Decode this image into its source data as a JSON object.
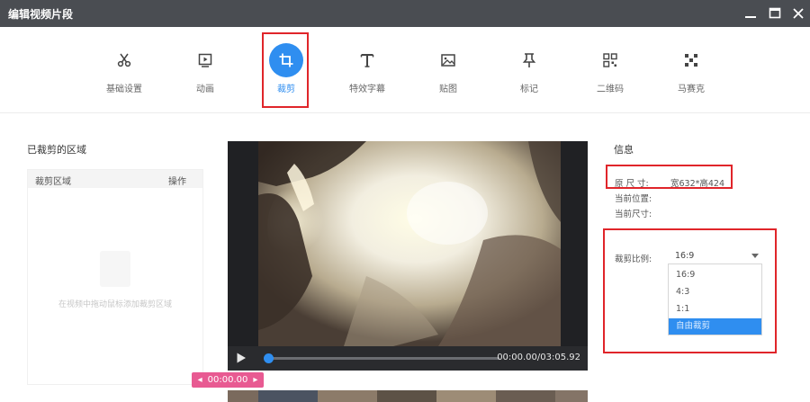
{
  "window": {
    "title": "编辑视频片段",
    "titlebar_color": "#4a4d52"
  },
  "toolbar": {
    "active_color": "#2f8ef0",
    "tools": [
      {
        "label": "基础设置",
        "icon": "scissors-icon"
      },
      {
        "label": "动画",
        "icon": "play-frame-icon"
      },
      {
        "label": "裁剪",
        "icon": "crop-icon"
      },
      {
        "label": "特效字幕",
        "icon": "text-icon"
      },
      {
        "label": "贴图",
        "icon": "image-icon"
      },
      {
        "label": "标记",
        "icon": "pin-icon"
      },
      {
        "label": "二维码",
        "icon": "qrcode-icon"
      },
      {
        "label": "马赛克",
        "icon": "mosaic-icon"
      }
    ],
    "active_index": 2
  },
  "crop_list": {
    "title": "已裁剪的区域",
    "col_area": "裁剪区域",
    "col_action": "操作",
    "empty_text": "在视频中拖动鼠标添加裁剪区域"
  },
  "player": {
    "time": "00:00.00/03:05.92",
    "progress": 0.0,
    "time_tag": "00:00.00"
  },
  "info": {
    "title": "信息",
    "size_label": "原 尺 寸:",
    "size_value": "宽632*高424",
    "pos_label": "当前位置:",
    "cur_size_label": "当前尺寸:",
    "ratio_label": "裁剪比例:",
    "ratio_selected": "16:9",
    "ratio_options": [
      "16:9",
      "4:3",
      "1:1",
      "自由裁剪"
    ],
    "ratio_highlight_index": 3
  }
}
